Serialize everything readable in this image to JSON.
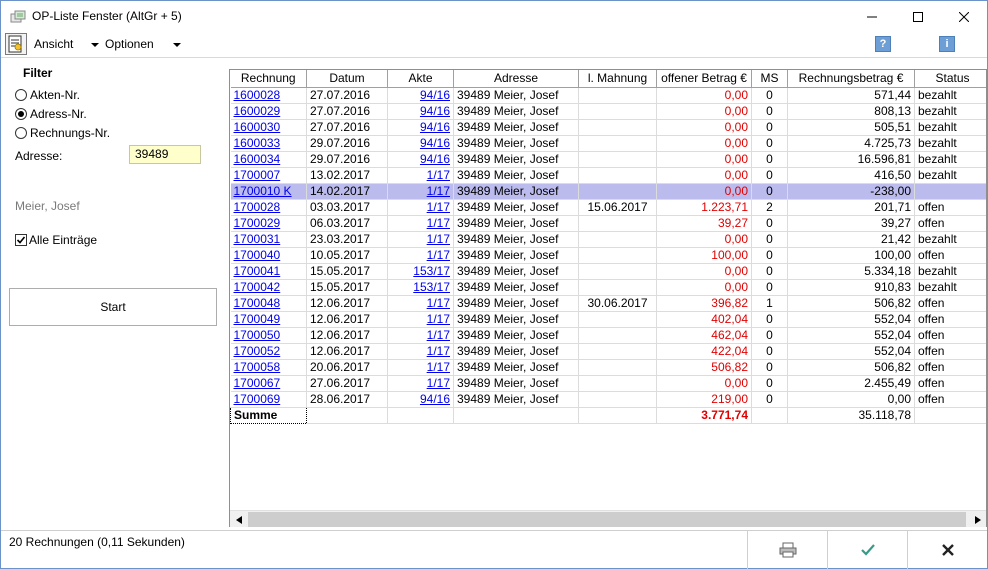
{
  "window": {
    "title": "OP-Liste Fenster (AltGr + 5)"
  },
  "menu": {
    "ansicht": "Ansicht",
    "optionen": "Optionen",
    "help": "?",
    "info": "i"
  },
  "filter": {
    "title": "Filter",
    "options": [
      "Akten-Nr.",
      "Adress-Nr.",
      "Rechnungs-Nr."
    ],
    "selected": "Adress-Nr.",
    "adresse_label": "Adresse:",
    "adresse_value": "39489",
    "name": "Meier, Josef",
    "alle_eintraege": "Alle Einträge",
    "alle_eintraege_checked": true,
    "start": "Start"
  },
  "table": {
    "columns": [
      "Rechnung",
      "Datum",
      "Akte",
      "Adresse",
      "l. Mahnung",
      "offener Betrag €",
      "MS",
      "Rechnungsbetrag €",
      "Status"
    ],
    "rows": [
      [
        "1600028",
        "27.07.2016",
        "94/16",
        "39489 Meier, Josef",
        "",
        "0,00",
        "0",
        "571,44",
        "bezahlt"
      ],
      [
        "1600029",
        "27.07.2016",
        "94/16",
        "39489 Meier, Josef",
        "",
        "0,00",
        "0",
        "808,13",
        "bezahlt"
      ],
      [
        "1600030",
        "27.07.2016",
        "94/16",
        "39489 Meier, Josef",
        "",
        "0,00",
        "0",
        "505,51",
        "bezahlt"
      ],
      [
        "1600033",
        "29.07.2016",
        "94/16",
        "39489 Meier, Josef",
        "",
        "0,00",
        "0",
        "4.725,73",
        "bezahlt"
      ],
      [
        "1600034",
        "29.07.2016",
        "94/16",
        "39489 Meier, Josef",
        "",
        "0,00",
        "0",
        "16.596,81",
        "bezahlt"
      ],
      [
        "1700007",
        "13.02.2017",
        "1/17",
        "39489 Meier, Josef",
        "",
        "0,00",
        "0",
        "416,50",
        "bezahlt"
      ],
      [
        "1700010 K",
        "14.02.2017",
        "1/17",
        "39489 Meier, Josef",
        "",
        "0,00",
        "0",
        "-238,00",
        ""
      ],
      [
        "1700028",
        "03.03.2017",
        "1/17",
        "39489 Meier, Josef",
        "15.06.2017",
        "1.223,71",
        "2",
        "201,71",
        "offen"
      ],
      [
        "1700029",
        "06.03.2017",
        "1/17",
        "39489 Meier, Josef",
        "",
        "39,27",
        "0",
        "39,27",
        "offen"
      ],
      [
        "1700031",
        "23.03.2017",
        "1/17",
        "39489 Meier, Josef",
        "",
        "0,00",
        "0",
        "21,42",
        "bezahlt"
      ],
      [
        "1700040",
        "10.05.2017",
        "1/17",
        "39489 Meier, Josef",
        "",
        "100,00",
        "0",
        "100,00",
        "offen"
      ],
      [
        "1700041",
        "15.05.2017",
        "153/17",
        "39489 Meier, Josef",
        "",
        "0,00",
        "0",
        "5.334,18",
        "bezahlt"
      ],
      [
        "1700042",
        "15.05.2017",
        "153/17",
        "39489 Meier, Josef",
        "",
        "0,00",
        "0",
        "910,83",
        "bezahlt"
      ],
      [
        "1700048",
        "12.06.2017",
        "1/17",
        "39489 Meier, Josef",
        "30.06.2017",
        "396,82",
        "1",
        "506,82",
        "offen"
      ],
      [
        "1700049",
        "12.06.2017",
        "1/17",
        "39489 Meier, Josef",
        "",
        "402,04",
        "0",
        "552,04",
        "offen"
      ],
      [
        "1700050",
        "12.06.2017",
        "1/17",
        "39489 Meier, Josef",
        "",
        "462,04",
        "0",
        "552,04",
        "offen"
      ],
      [
        "1700052",
        "12.06.2017",
        "1/17",
        "39489 Meier, Josef",
        "",
        "422,04",
        "0",
        "552,04",
        "offen"
      ],
      [
        "1700058",
        "20.06.2017",
        "1/17",
        "39489 Meier, Josef",
        "",
        "506,82",
        "0",
        "506,82",
        "offen"
      ],
      [
        "1700067",
        "27.06.2017",
        "1/17",
        "39489 Meier, Josef",
        "",
        "0,00",
        "0",
        "2.455,49",
        "offen"
      ],
      [
        "1700069",
        "28.06.2017",
        "94/16",
        "39489 Meier, Josef",
        "",
        "219,00",
        "0",
        "0,00",
        "offen"
      ]
    ],
    "selected_row": 6,
    "sum_label": "Summe",
    "sum_offen": "3.771,74",
    "sum_rechnung": "35.118,78"
  },
  "status": {
    "text": "20 Rechnungen (0,11 Sekunden)"
  },
  "colors": {
    "link": "#0000ee",
    "amount_red": "#e00000",
    "selection": "#bbbbee",
    "input_bg": "#ffffcc"
  }
}
